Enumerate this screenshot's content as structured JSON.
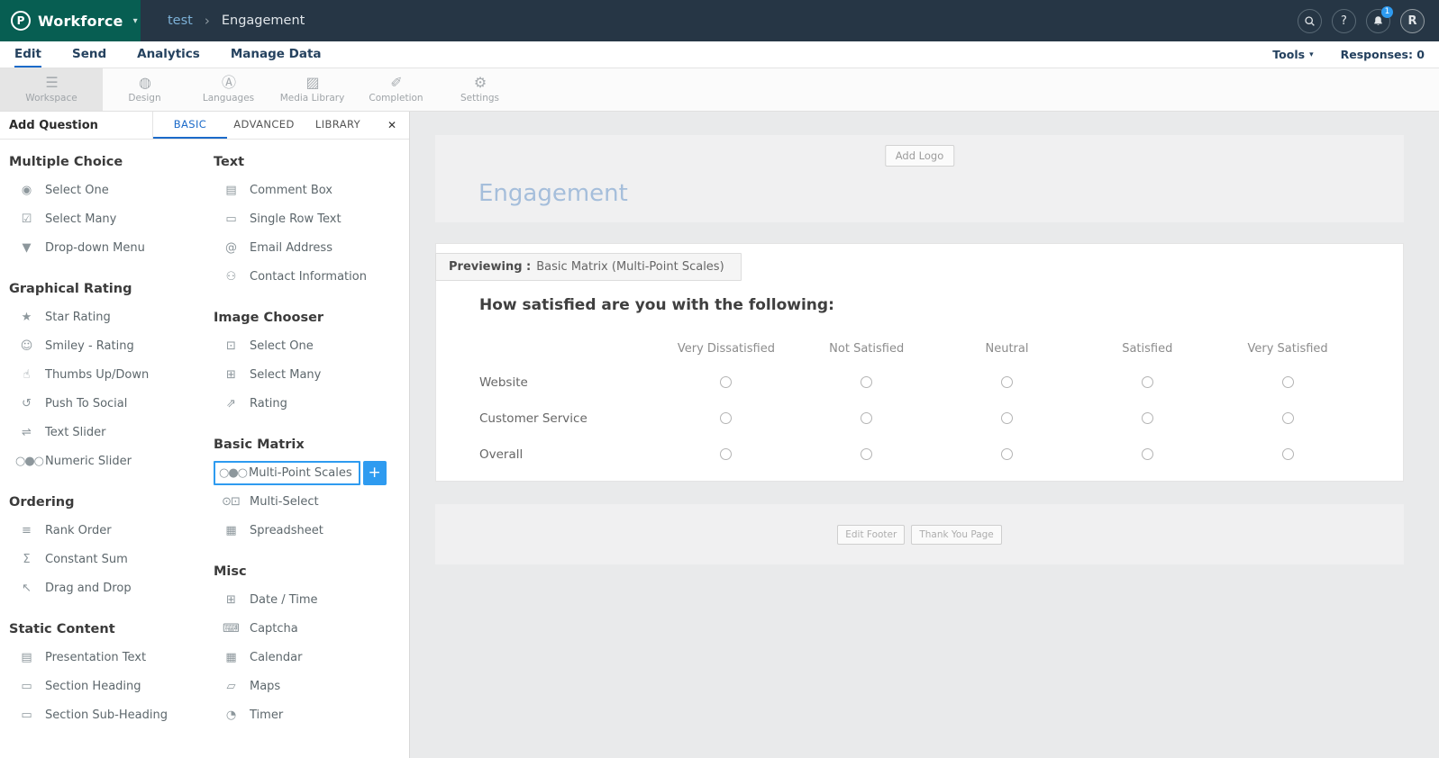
{
  "topbar": {
    "logo_glyph": "P",
    "brand": "Workforce",
    "caret": "▾",
    "breadcrumb": {
      "parent": "test",
      "separator": "›",
      "current": "Engagement"
    },
    "help_glyph": "?",
    "notification_count": "1",
    "avatar_initial": "R"
  },
  "nav": {
    "tabs": [
      "Edit",
      "Send",
      "Analytics",
      "Manage Data"
    ],
    "active_tab": "Edit",
    "tools_label": "Tools",
    "tools_caret": "▾",
    "responses_label": "Responses: 0"
  },
  "toolbar": {
    "active": "Workspace",
    "items": [
      {
        "label": "Workspace",
        "icon": "workspace"
      },
      {
        "label": "Design",
        "icon": "design"
      },
      {
        "label": "Languages",
        "icon": "languages"
      },
      {
        "label": "Media Library",
        "icon": "media-library"
      },
      {
        "label": "Completion",
        "icon": "completion"
      },
      {
        "label": "Settings",
        "icon": "settings"
      }
    ]
  },
  "panel": {
    "title": "Add Question",
    "tabs": [
      "BASIC",
      "ADVANCED",
      "LIBRARY"
    ],
    "active_tab": "BASIC",
    "close_glyph": "✕",
    "columns": [
      [
        {
          "heading": "Multiple Choice",
          "items": [
            {
              "label": "Select One",
              "icon": "select-one"
            },
            {
              "label": "Select Many",
              "icon": "select-many"
            },
            {
              "label": "Drop-down Menu",
              "icon": "dropdown-menu"
            }
          ]
        },
        {
          "heading": "Graphical Rating",
          "items": [
            {
              "label": "Star Rating",
              "icon": "star-rating"
            },
            {
              "label": "Smiley - Rating",
              "icon": "smiley-rating"
            },
            {
              "label": "Thumbs Up/Down",
              "icon": "thumbs"
            },
            {
              "label": "Push To Social",
              "icon": "push-to-social"
            },
            {
              "label": "Text Slider",
              "icon": "text-slider"
            },
            {
              "label": "Numeric Slider",
              "icon": "numeric-slider"
            }
          ]
        },
        {
          "heading": "Ordering",
          "items": [
            {
              "label": "Rank Order",
              "icon": "rank-order"
            },
            {
              "label": "Constant Sum",
              "icon": "constant-sum"
            },
            {
              "label": "Drag and Drop",
              "icon": "drag-and-drop"
            }
          ]
        },
        {
          "heading": "Static Content",
          "items": [
            {
              "label": "Presentation Text",
              "icon": "presentation-text"
            },
            {
              "label": "Section Heading",
              "icon": "section-heading"
            },
            {
              "label": "Section Sub-Heading",
              "icon": "section-sub-heading"
            }
          ]
        }
      ],
      [
        {
          "heading": "Text",
          "items": [
            {
              "label": "Comment Box",
              "icon": "comment-box"
            },
            {
              "label": "Single Row Text",
              "icon": "single-row-text"
            },
            {
              "label": "Email Address",
              "icon": "email-address"
            },
            {
              "label": "Contact Information",
              "icon": "contact-information"
            }
          ]
        },
        {
          "heading": "Image Chooser",
          "items": [
            {
              "label": "Select One",
              "icon": "image-select-one"
            },
            {
              "label": "Select Many",
              "icon": "image-select-many"
            },
            {
              "label": "Rating",
              "icon": "image-rating"
            }
          ]
        },
        {
          "heading": "Basic Matrix",
          "items": [
            {
              "label": "Multi-Point Scales",
              "icon": "multi-point-scales",
              "selected": true
            },
            {
              "label": "Multi-Select",
              "icon": "multi-select"
            },
            {
              "label": "Spreadsheet",
              "icon": "spreadsheet"
            }
          ]
        },
        {
          "heading": "Misc",
          "items": [
            {
              "label": "Date / Time",
              "icon": "date-time"
            },
            {
              "label": "Captcha",
              "icon": "captcha"
            },
            {
              "label": "Calendar",
              "icon": "calendar"
            },
            {
              "label": "Maps",
              "icon": "maps"
            },
            {
              "label": "Timer",
              "icon": "timer"
            }
          ]
        }
      ]
    ]
  },
  "preview": {
    "add_logo_label": "Add Logo",
    "survey_title": "Engagement",
    "previewing_label": "Previewing :",
    "previewing_value": "Basic Matrix (Multi-Point Scales)",
    "question_title": "How satisfied are you with the following:",
    "matrix": {
      "columns": [
        "Very Dissatisfied",
        "Not Satisfied",
        "Neutral",
        "Satisfied",
        "Very Satisfied"
      ],
      "rows": [
        "Website",
        "Customer Service",
        "Overall"
      ]
    },
    "footer_buttons": [
      "Edit Footer",
      "Thank You Page"
    ]
  },
  "colors": {
    "accent_blue": "#2e9bf0",
    "nav_blue": "#1b6ac9",
    "brand_teal": "#075e52",
    "topbar_navy": "#263645"
  }
}
